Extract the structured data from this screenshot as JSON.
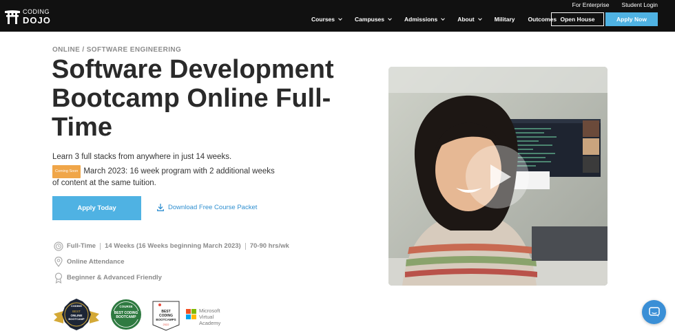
{
  "brand": {
    "line1": "CODING",
    "line2": "DOJO"
  },
  "utility_links": [
    "For Enterprise",
    "Student Login"
  ],
  "nav": {
    "items": [
      {
        "label": "Courses",
        "dropdown": true
      },
      {
        "label": "Campuses",
        "dropdown": true
      },
      {
        "label": "Admissions",
        "dropdown": true
      },
      {
        "label": "About",
        "dropdown": true
      },
      {
        "label": "Military",
        "dropdown": false
      },
      {
        "label": "Outcomes",
        "dropdown": false
      }
    ],
    "open_house": "Open House",
    "apply_now": "Apply Now"
  },
  "hero": {
    "breadcrumb": "ONLINE / SOFTWARE ENGINEERING",
    "title": "Software Development Bootcamp Online Full-Time",
    "lead": "Learn 3 full stacks from anywhere in just 14 weeks.",
    "badge": "Coming Soon",
    "note": "March 2023: 16 week program with 2 additional weeks of content at the same tuition.",
    "cta": "Apply Today",
    "download": "Download Free Course Packet"
  },
  "features": {
    "schedule": "Full-Time",
    "duration": "14 Weeks (16 Weeks beginning March 2023)",
    "hours": "70-90 hrs/wk",
    "location": "Online Attendance",
    "level": "Beginner & Advanced Friendly"
  },
  "awards": {
    "a1": {
      "l1": "CODING",
      "l2": "BEST",
      "l3": "ONLINE",
      "l4": "BOOTCAMP"
    },
    "a2": {
      "l1": "COURSE",
      "l2": "BEST CODING",
      "l3": "BOOTCAMP"
    },
    "a3": {
      "l1": "BEST",
      "l2": "CODING",
      "l3": "BOOTCAMPS",
      "l4": "2022"
    },
    "a4": {
      "l1": "Microsoft",
      "l2": "Virtual",
      "l3": "Academy"
    }
  },
  "colors": {
    "accent": "#4fb2e3",
    "badge": "#f0a649",
    "nav_bg": "#111111",
    "link": "#2f8fd0"
  }
}
